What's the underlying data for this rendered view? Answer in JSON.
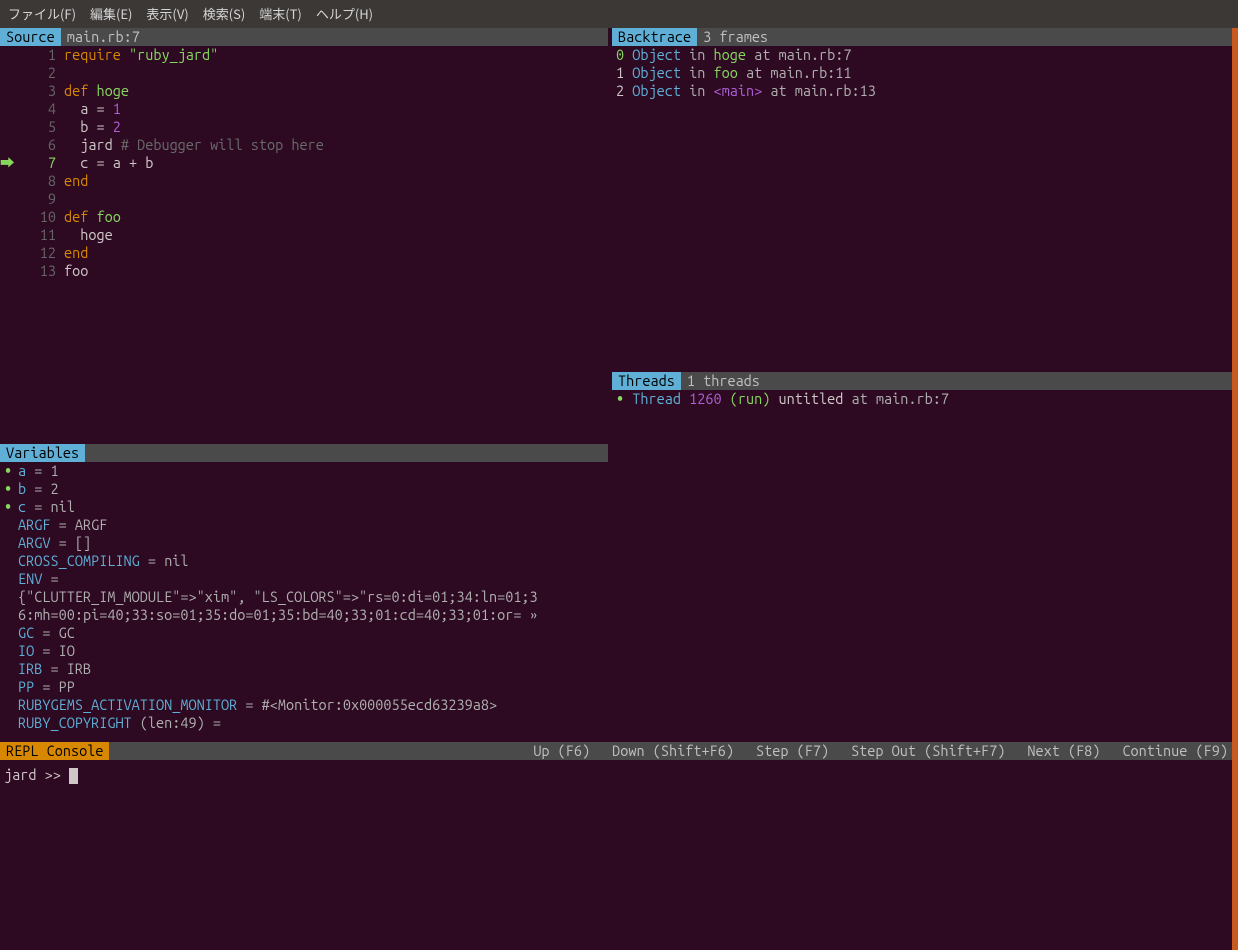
{
  "menubar": {
    "items": [
      "ファイル(F)",
      "編集(E)",
      "表示(V)",
      "検索(S)",
      "端末(T)",
      "ヘルプ(H)"
    ]
  },
  "source": {
    "title": "Source",
    "sub": "main.rb:7",
    "current_line": 7,
    "lines": [
      {
        "n": 1,
        "tokens": [
          [
            "kw",
            "require"
          ],
          [
            "ident",
            " "
          ],
          [
            "str",
            "\"ruby_jard\""
          ]
        ]
      },
      {
        "n": 2,
        "tokens": []
      },
      {
        "n": 3,
        "tokens": [
          [
            "kw",
            "def"
          ],
          [
            "ident",
            " "
          ],
          [
            "kw2",
            "hoge"
          ]
        ]
      },
      {
        "n": 4,
        "tokens": [
          [
            "ident",
            "  a = "
          ],
          [
            "num",
            "1"
          ]
        ]
      },
      {
        "n": 5,
        "tokens": [
          [
            "ident",
            "  b = "
          ],
          [
            "num",
            "2"
          ]
        ]
      },
      {
        "n": 6,
        "tokens": [
          [
            "ident",
            "  jard "
          ],
          [
            "comment",
            "# Debugger will stop here"
          ]
        ]
      },
      {
        "n": 7,
        "tokens": [
          [
            "ident",
            "  c = a + b"
          ]
        ]
      },
      {
        "n": 8,
        "tokens": [
          [
            "kw",
            "end"
          ]
        ]
      },
      {
        "n": 9,
        "tokens": []
      },
      {
        "n": 10,
        "tokens": [
          [
            "kw",
            "def"
          ],
          [
            "ident",
            " "
          ],
          [
            "kw2",
            "foo"
          ]
        ]
      },
      {
        "n": 11,
        "tokens": [
          [
            "ident",
            "  hoge"
          ]
        ]
      },
      {
        "n": 12,
        "tokens": [
          [
            "kw",
            "end"
          ]
        ]
      },
      {
        "n": 13,
        "tokens": [
          [
            "ident",
            "foo"
          ]
        ]
      }
    ]
  },
  "variables": {
    "title": "Variables",
    "items": [
      {
        "bullet": true,
        "name": "a",
        "eq": " = ",
        "value": "1"
      },
      {
        "bullet": true,
        "name": "b",
        "eq": " = ",
        "value": "2"
      },
      {
        "bullet": true,
        "name": "c",
        "eq": " = ",
        "value": "nil"
      },
      {
        "bullet": false,
        "name": "ARGF",
        "eq": " = ",
        "value": "ARGF"
      },
      {
        "bullet": false,
        "name": "ARGV",
        "eq": " = ",
        "value": "[]"
      },
      {
        "bullet": false,
        "name": "CROSS_COMPILING",
        "eq": " = ",
        "value": "nil"
      },
      {
        "bullet": false,
        "name": "ENV",
        "eq": " =",
        "value": ""
      },
      {
        "bullet": false,
        "raw": "{\"CLUTTER_IM_MODULE\"=>\"xim\", \"LS_COLORS\"=>\"rs=0:di=01;34:ln=01;3"
      },
      {
        "bullet": false,
        "raw": "6:mh=00:pi=40;33:so=01;35:do=01;35:bd=40;33;01:cd=40;33;01:or= »"
      },
      {
        "bullet": false,
        "name": "GC",
        "eq": " = ",
        "value": "GC"
      },
      {
        "bullet": false,
        "name": "IO",
        "eq": " = ",
        "value": "IO"
      },
      {
        "bullet": false,
        "name": "IRB",
        "eq": " = ",
        "value": "IRB"
      },
      {
        "bullet": false,
        "name": "PP",
        "eq": " = ",
        "value": "PP"
      },
      {
        "bullet": false,
        "name": "RUBYGEMS_ACTIVATION_MONITOR",
        "eq": " = ",
        "value": "#<Monitor:0x000055ecd63239a8>"
      },
      {
        "bullet": false,
        "name": "RUBY_COPYRIGHT",
        "eq": " ",
        "value": "(len:49) ="
      }
    ]
  },
  "backtrace": {
    "title": "Backtrace",
    "sub": "3 frames",
    "frames": [
      {
        "idx": "0",
        "idx_class": "idx-green",
        "obj": "Object",
        "in": "in",
        "fn": "hoge",
        "fn_class": "green",
        "at": "at main.rb:7"
      },
      {
        "idx": "1",
        "idx_class": "idx-white",
        "obj": "Object",
        "in": "in",
        "fn": "foo",
        "fn_class": "green",
        "at": "at main.rb:11"
      },
      {
        "idx": "2",
        "idx_class": "idx-white",
        "obj": "Object",
        "in": "in",
        "fn": "<main>",
        "fn_class": "purple",
        "at": "at main.rb:13"
      }
    ]
  },
  "threads": {
    "title": "Threads",
    "sub": "1 threads",
    "items": [
      {
        "label": "Thread",
        "id": "1260",
        "state": "(run)",
        "name": "untitled",
        "at": "at main.rb:7"
      }
    ]
  },
  "repl": {
    "title": "REPL Console",
    "shortcuts": [
      "Up (F6)",
      "Down (Shift+F6)",
      "Step (F7)",
      "Step Out (Shift+F7)",
      "Next (F8)",
      "Continue (F9)"
    ],
    "prompt": "jard >> "
  }
}
